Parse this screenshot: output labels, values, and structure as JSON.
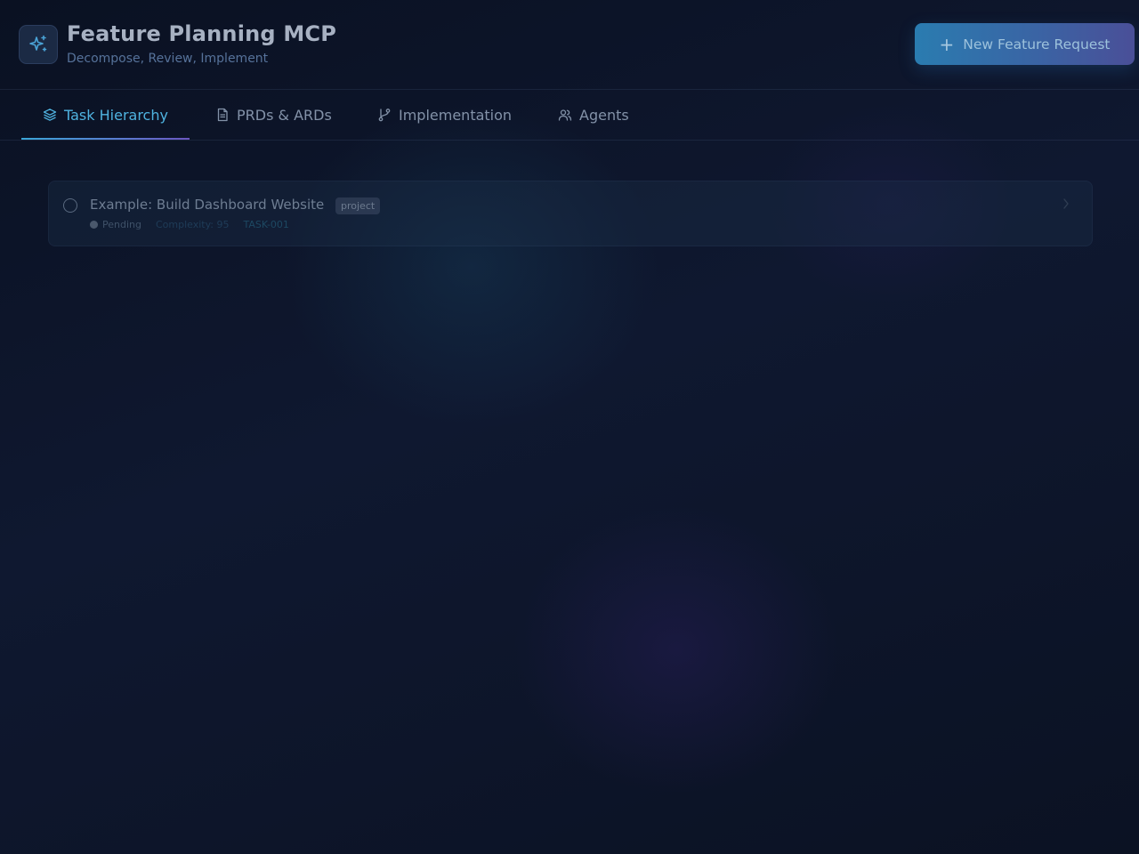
{
  "header": {
    "title": "Feature Planning MCP",
    "subtitle": "Decompose, Review, Implement",
    "logo_icon": "sparkles-icon",
    "new_button": {
      "label": "New Feature Request",
      "icon": "plus-icon"
    }
  },
  "tabs": [
    {
      "label": "Task Hierarchy",
      "icon": "layers-icon",
      "active": true
    },
    {
      "label": "PRDs & ARDs",
      "icon": "document-icon",
      "active": false
    },
    {
      "label": "Implementation",
      "icon": "git-branch-icon",
      "active": false
    },
    {
      "label": "Agents",
      "icon": "users-icon",
      "active": false
    }
  ],
  "tasks": [
    {
      "title": "Example: Build Dashboard Website",
      "type": "project",
      "status": "Pending",
      "complexity": "Complexity: 95",
      "id": "TASK-001"
    }
  ],
  "colors": {
    "accent": "#4fb3e0",
    "background": "#0b1222",
    "button_gradient_start": "#2a7cb0",
    "button_gradient_end": "#4a4f98"
  }
}
